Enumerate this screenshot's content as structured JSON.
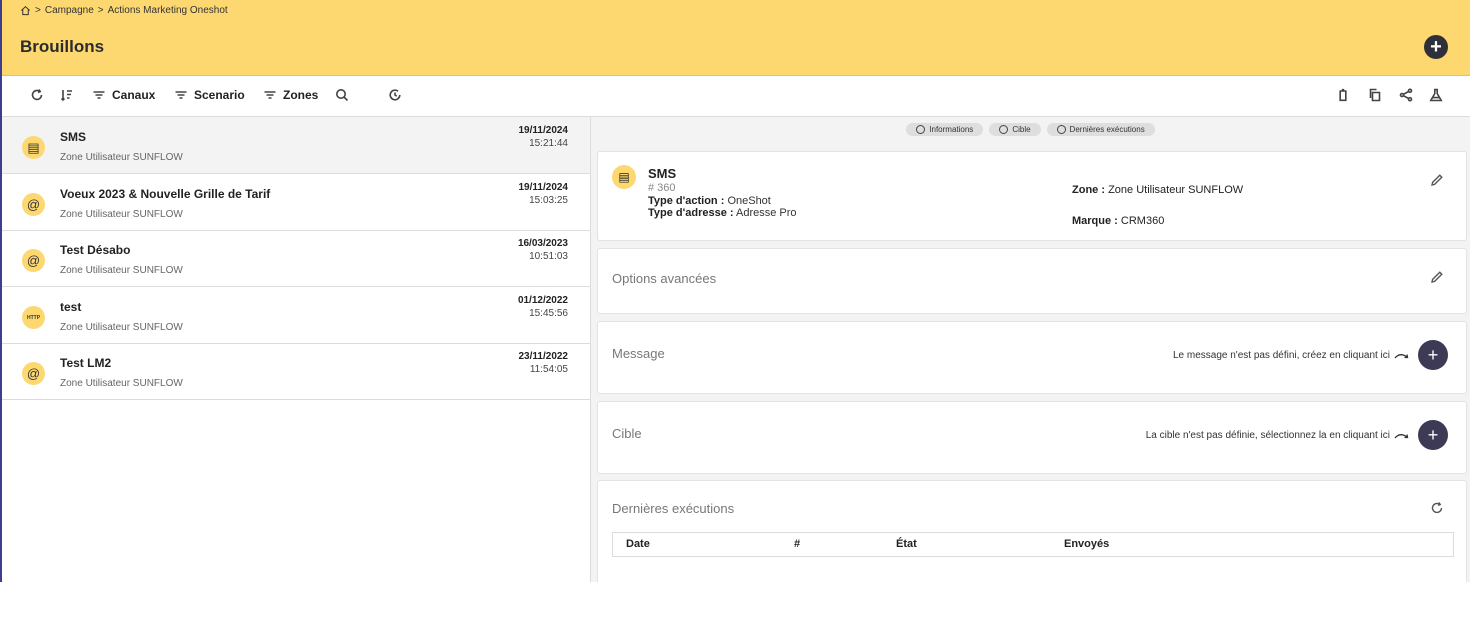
{
  "breadcrumb": {
    "items": [
      "Campagne",
      "Actions Marketing Oneshot"
    ],
    "sep": ">"
  },
  "header": {
    "title": "Brouillons",
    "add_label": "+"
  },
  "toolbar": {
    "canaux": "Canaux",
    "scenario": "Scenario",
    "zones": "Zones"
  },
  "list": [
    {
      "icon": "sms-icon",
      "avatar": "▤",
      "title": "SMS",
      "sub": "Zone Utilisateur SUNFLOW",
      "date": "19/11/2024",
      "time": "15:21:44",
      "selected": true
    },
    {
      "icon": "at-icon",
      "avatar": "@",
      "title": "Voeux 2023 & Nouvelle Grille de Tarif",
      "sub": "Zone Utilisateur SUNFLOW",
      "date": "19/11/2024",
      "time": "15:03:25"
    },
    {
      "icon": "at-icon",
      "avatar": "@",
      "title": "Test Désabo",
      "sub": "Zone Utilisateur SUNFLOW",
      "date": "16/03/2023",
      "time": "10:51:03"
    },
    {
      "icon": "http-icon",
      "avatar": "HTTP",
      "title": "test",
      "sub": "Zone Utilisateur SUNFLOW",
      "date": "01/12/2022",
      "time": "15:45:56"
    },
    {
      "icon": "at-icon",
      "avatar": "@",
      "title": "Test LM2",
      "sub": "Zone Utilisateur SUNFLOW",
      "date": "23/11/2022",
      "time": "11:54:05"
    }
  ],
  "detail": {
    "chips": [
      "Informations",
      "Cible",
      "Dernières exécutions"
    ],
    "info": {
      "title": "SMS",
      "id": "# 360",
      "type_action_label": "Type d'action :",
      "type_action_value": "OneShot",
      "type_adresse_label": "Type d'adresse :",
      "type_adresse_value": "Adresse Pro",
      "zone_label": "Zone :",
      "zone_value": "Zone Utilisateur SUNFLOW",
      "marque_label": "Marque :",
      "marque_value": "CRM360"
    },
    "options_label": "Options avancées",
    "message_label": "Message",
    "message_hint": "Le message n'est pas défini, créez en cliquant ici",
    "cible_label": "Cible",
    "cible_hint": "La cible n'est pas définie, sélectionnez la en cliquant ici",
    "exec_label": "Dernières exécutions",
    "exec_columns": [
      "Date",
      "#",
      "État",
      "Envoyés"
    ]
  },
  "colors": {
    "header_bg": "#fdd870",
    "accent_dark": "#3d3a55"
  }
}
